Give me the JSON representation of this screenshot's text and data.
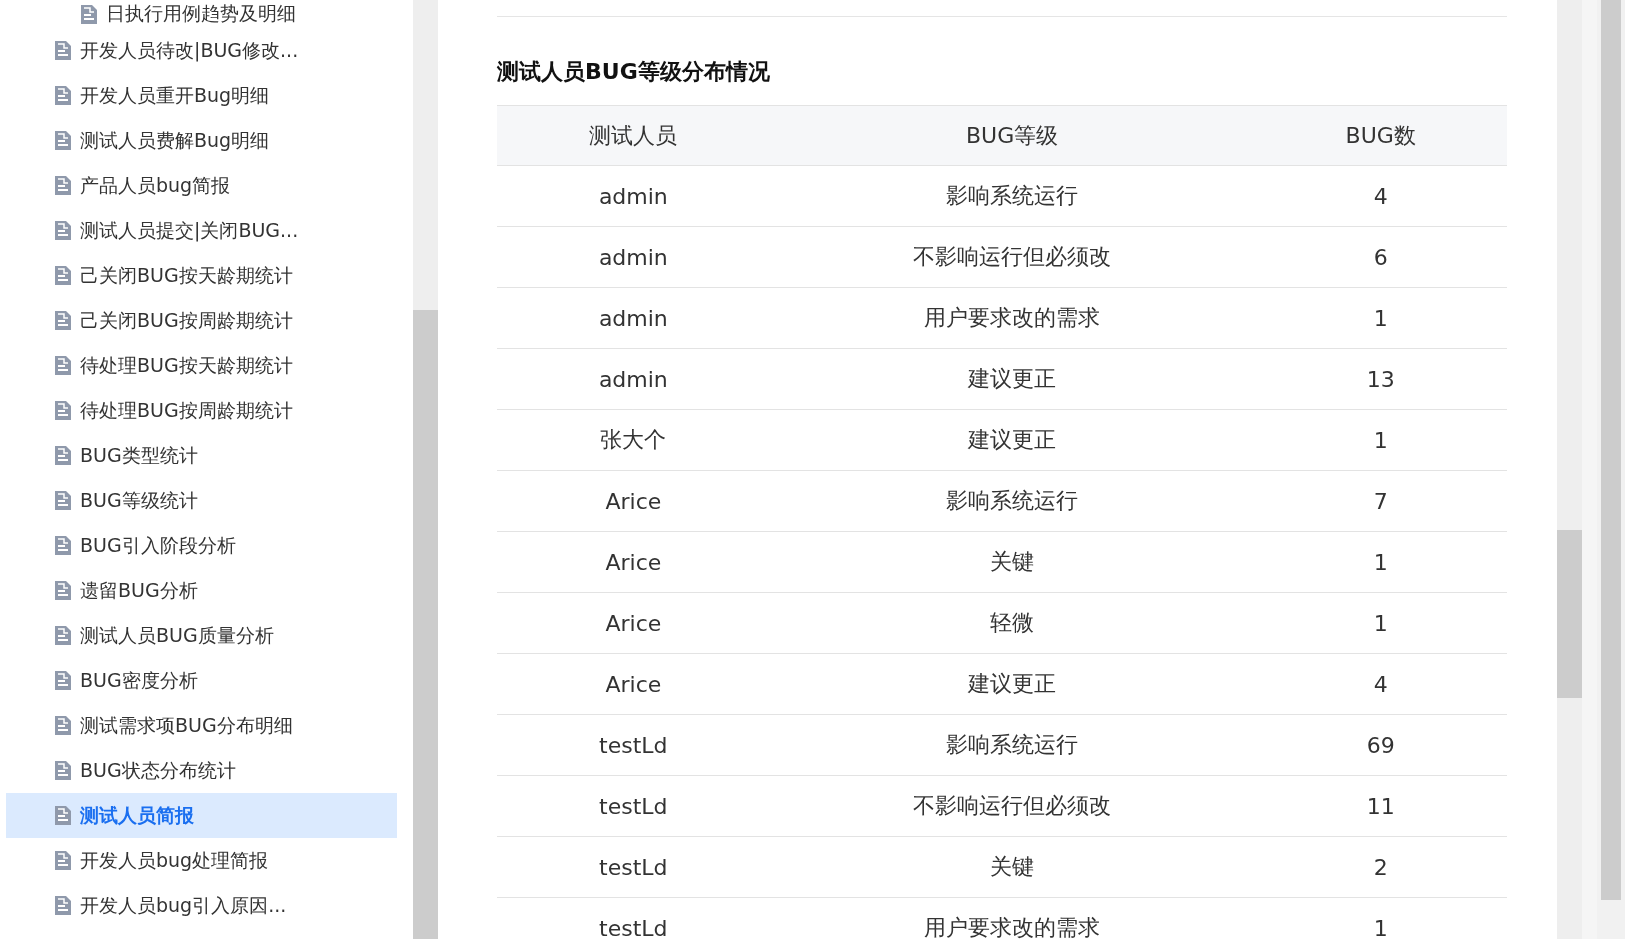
{
  "sidebar": {
    "items": [
      {
        "label": "日执行用例趋势及明细",
        "selected": false,
        "nested": true
      },
      {
        "label": "开发人员待改|BUG修改...",
        "selected": false
      },
      {
        "label": "开发人员重开Bug明细",
        "selected": false
      },
      {
        "label": "测试人员费解Bug明细",
        "selected": false
      },
      {
        "label": "产品人员bug简报",
        "selected": false
      },
      {
        "label": "测试人员提交|关闭BUG...",
        "selected": false
      },
      {
        "label": "己关闭BUG按天龄期统计",
        "selected": false
      },
      {
        "label": "己关闭BUG按周龄期统计",
        "selected": false
      },
      {
        "label": "待处理BUG按天龄期统计",
        "selected": false
      },
      {
        "label": "待处理BUG按周龄期统计",
        "selected": false
      },
      {
        "label": "BUG类型统计",
        "selected": false
      },
      {
        "label": "BUG等级统计",
        "selected": false
      },
      {
        "label": "BUG引入阶段分析",
        "selected": false
      },
      {
        "label": "遗留BUG分析",
        "selected": false
      },
      {
        "label": "测试人员BUG质量分析",
        "selected": false
      },
      {
        "label": "BUG密度分析",
        "selected": false
      },
      {
        "label": "测试需求项BUG分布明细",
        "selected": false
      },
      {
        "label": "BUG状态分布统计",
        "selected": false
      },
      {
        "label": "测试人员简报",
        "selected": true
      },
      {
        "label": "开发人员bug处理简报",
        "selected": false
      },
      {
        "label": "开发人员bug引入原因...",
        "selected": false
      }
    ]
  },
  "report": {
    "title": "测试人员BUG等级分布情况",
    "table": {
      "columns": [
        "测试人员",
        "BUG等级",
        "BUG数"
      ],
      "rows": [
        [
          "admin",
          "影响系统运行",
          "4"
        ],
        [
          "admin",
          "不影响运行但必须改",
          "6"
        ],
        [
          "admin",
          "用户要求改的需求",
          "1"
        ],
        [
          "admin",
          "建议更正",
          "13"
        ],
        [
          "张大个",
          "建议更正",
          "1"
        ],
        [
          "Arice",
          "影响系统运行",
          "7"
        ],
        [
          "Arice",
          "关键",
          "1"
        ],
        [
          "Arice",
          "轻微",
          "1"
        ],
        [
          "Arice",
          "建议更正",
          "4"
        ],
        [
          "testLd",
          "影响系统运行",
          "69"
        ],
        [
          "testLd",
          "不影响运行但必须改",
          "11"
        ],
        [
          "testLd",
          "关键",
          "2"
        ],
        [
          "testLd",
          "用户要求改的需求",
          "1"
        ]
      ]
    }
  }
}
